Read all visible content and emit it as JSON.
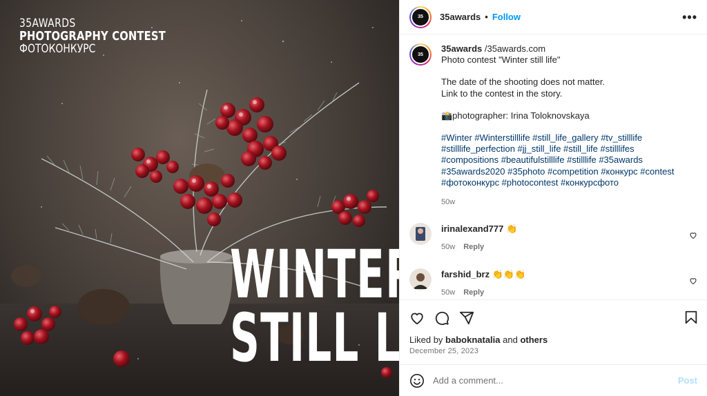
{
  "image": {
    "brand_line1": "35AWARDS",
    "brand_line2": "PHOTOGRAPHY CONTEST",
    "brand_line3": "ФОТОКОНКУРС",
    "title_line1": "WINTER",
    "title_line2": "STILL LIFE"
  },
  "header": {
    "username": "35awards",
    "separator": "•",
    "follow_label": "Follow",
    "more_label": "•••",
    "avatar_text": "35"
  },
  "caption": {
    "username": "35awards",
    "line1_rest": " /35awards.com",
    "line2": "Photo contest \"Winter still life\"",
    "line3": "The date of the shooting does not matter.",
    "line4": "Link to the contest in the story.",
    "line5": "📸photographer: Irina Toloknovskaya",
    "hashtags": [
      "#Winter #Winterstilllife #still_life_gallery #tv_stilllife",
      "#stilllife_perfection #jj_still_life #still_life #stilllifes",
      "#compositions #beautifulstilllife #stilllife #35awards",
      "#35awards2020 #35photo #competition #конкурс #contest",
      "#фотоконкурс #photocontest #конкурсфото"
    ],
    "age": "50w"
  },
  "comments": [
    {
      "username": "irinalexand777",
      "text": " 👏",
      "age": "50w",
      "reply_label": "Reply"
    },
    {
      "username": "farshid_brz",
      "text": " 👏👏👏",
      "age": "50w",
      "reply_label": "Reply"
    }
  ],
  "likes": {
    "prefix": "Liked by ",
    "user": "baboknatalia",
    "middle": " and ",
    "others": "others"
  },
  "date": "December 25, 2023",
  "add_comment": {
    "placeholder": "Add a comment...",
    "post_label": "Post"
  },
  "colors": {
    "link_blue": "#0095f6",
    "hashtag": "#00376b",
    "muted": "#737373"
  }
}
